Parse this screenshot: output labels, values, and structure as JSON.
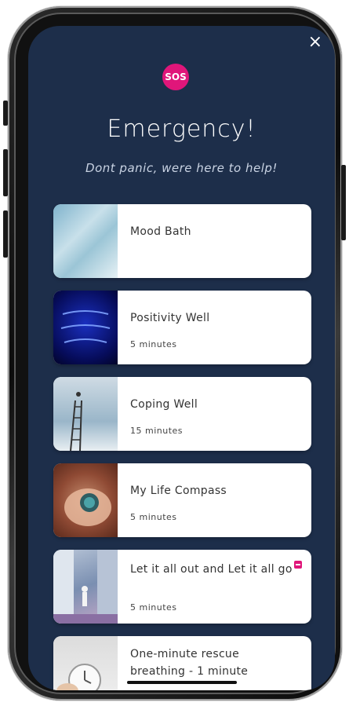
{
  "header": {
    "close_glyph": "×",
    "sos_badge": "SOS",
    "title": "Emergency!",
    "subtitle": "Dont panic, were here to help!"
  },
  "cards": [
    {
      "title": "Mood Bath",
      "subtitle": "",
      "thumb_icon": "water-image-icon"
    },
    {
      "title": "Positivity Well",
      "subtitle": "5 minutes",
      "thumb_icon": "neon-sign-image-icon"
    },
    {
      "title": "Coping Well",
      "subtitle": "15 minutes",
      "thumb_icon": "ladder-sky-image-icon"
    },
    {
      "title": "My Life Compass",
      "subtitle": "5 minutes",
      "thumb_icon": "compass-hand-image-icon"
    },
    {
      "title": "Let it all out and Let it all go",
      "subtitle": "5 minutes",
      "thumb_icon": "street-image-icon",
      "badge": true
    },
    {
      "title": "One-minute rescue breathing - 1 minute",
      "subtitle": "",
      "thumb_icon": "alarm-clock-image-icon"
    }
  ],
  "colors": {
    "screen_bg": "#1d2e4a",
    "accent": "#e0167a",
    "card_bg": "#ffffff"
  }
}
